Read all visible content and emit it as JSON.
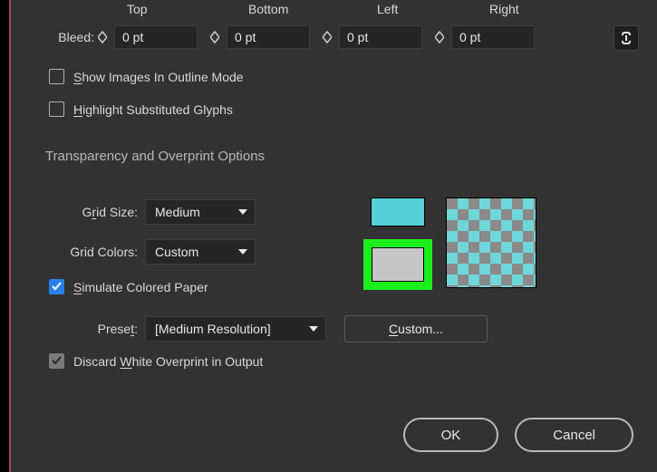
{
  "bleed": {
    "label": "Bleed:",
    "headers": {
      "top": "Top",
      "bottom": "Bottom",
      "left": "Left",
      "right": "Right"
    },
    "values": {
      "top": "0 pt",
      "bottom": "0 pt",
      "left": "0 pt",
      "right": "0 pt"
    }
  },
  "checkboxes": {
    "show_images": {
      "label_pre": "S",
      "label_mid": "how Images In Outline Mode",
      "checked": false
    },
    "highlight": {
      "label_pre": "H",
      "label_mid": "ighlight Substituted Glyphs",
      "checked": false
    },
    "simulate": {
      "label_pre": "S",
      "label_mid": "imulate Colored Paper",
      "checked": true
    },
    "discard": {
      "label_pre": "Discard ",
      "underl": "W",
      "label_post": "hite Overprint in Output",
      "checked": true
    }
  },
  "section_title": "Transparency and Overprint Options",
  "grid_size": {
    "label_pre": "G",
    "underl": "r",
    "label_post": "id Size:",
    "value": "Medium"
  },
  "grid_colors": {
    "label": "Grid Colors:",
    "value": "Custom"
  },
  "preset": {
    "label_pre": "Prese",
    "underl": "t",
    "label_post": ":",
    "value": "[Medium Resolution]"
  },
  "custom_btn": {
    "pre": "",
    "underl": "C",
    "post": "ustom..."
  },
  "swatches": {
    "top_color": "#56cfd6",
    "frame_color": "#1cf01c",
    "inner_color": "#c6c6c6"
  },
  "footer": {
    "ok": "OK",
    "cancel": "Cancel"
  }
}
